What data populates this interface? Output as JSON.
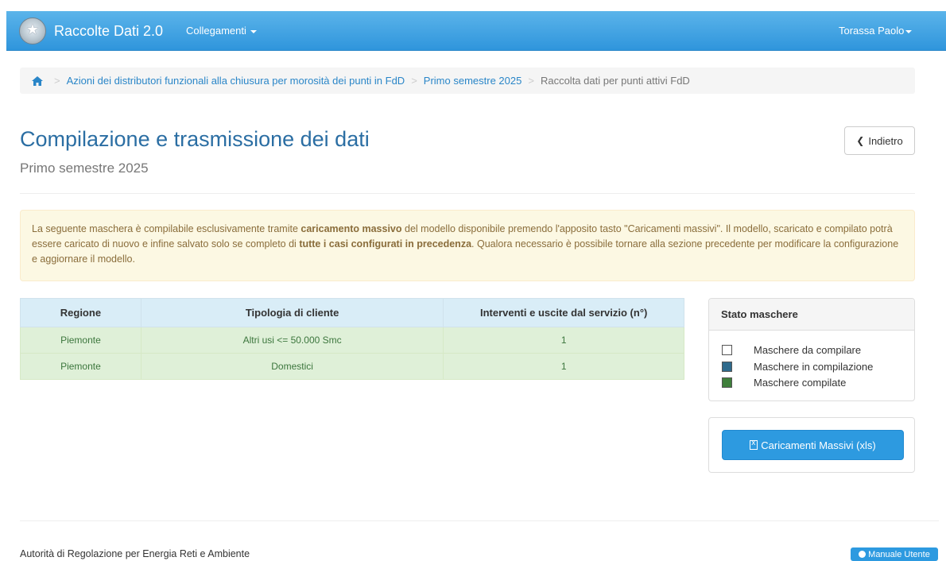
{
  "navbar": {
    "brand": "Raccolte Dati 2.0",
    "links_label": "Collegamenti",
    "user": "Torassa Paolo"
  },
  "breadcrumb": {
    "item1": "Azioni dei distributori funzionali alla chiusura per morosità dei punti in FdD",
    "item2": "Primo semestre 2025",
    "active": "Raccolta dati per punti attivi FdD"
  },
  "header": {
    "title": "Compilazione e trasmissione dei dati",
    "subtitle": "Primo semestre 2025",
    "back_label": "Indietro"
  },
  "alert": {
    "p1": "La seguente maschera è compilabile esclusivamente tramite ",
    "b1": "caricamento massivo",
    "p2": " del modello disponibile premendo l'apposito tasto \"Caricamenti massivi\". Il modello, scaricato e compilato potrà essere caricato di nuovo e infine salvato solo se completo di ",
    "b2": "tutte i casi configurati in precedenza",
    "p3": ". Qualora necessario è possibile tornare alla sezione precedente per modificare la configurazione e aggiornare il modello."
  },
  "table": {
    "headers": [
      "Regione",
      "Tipologia di cliente",
      "Interventi e uscite dal servizio (n°)"
    ],
    "rows": [
      [
        "Piemonte",
        "Altri usi <= 50.000 Smc",
        "1"
      ],
      [
        "Piemonte",
        "Domestici",
        "1"
      ]
    ]
  },
  "status_panel": {
    "title": "Stato maschere",
    "legend": [
      {
        "label": "Maschere da compilare",
        "color": "#ffffff"
      },
      {
        "label": "Maschere in compilazione",
        "color": "#2f6a8c"
      },
      {
        "label": "Maschere compilate",
        "color": "#3f7f3b"
      }
    ]
  },
  "bulk_button": "Caricamenti Massivi (xls)",
  "footer": {
    "text": "Autorità di Regolazione per Energia Reti e Ambiente",
    "manual": "Manuale Utente"
  },
  "colors": {
    "navbar": "#2f95dc",
    "title": "#2b6ea3",
    "link": "#2a86c8",
    "alert_bg": "#fcf8e3",
    "header_bg": "#d9edf7",
    "row_bg": "#dff0d8"
  },
  "icons": [
    "emblem-icon",
    "home-icon",
    "caret-down-icon",
    "chevron-left-icon",
    "file-excel-icon",
    "info-circle-icon"
  ]
}
